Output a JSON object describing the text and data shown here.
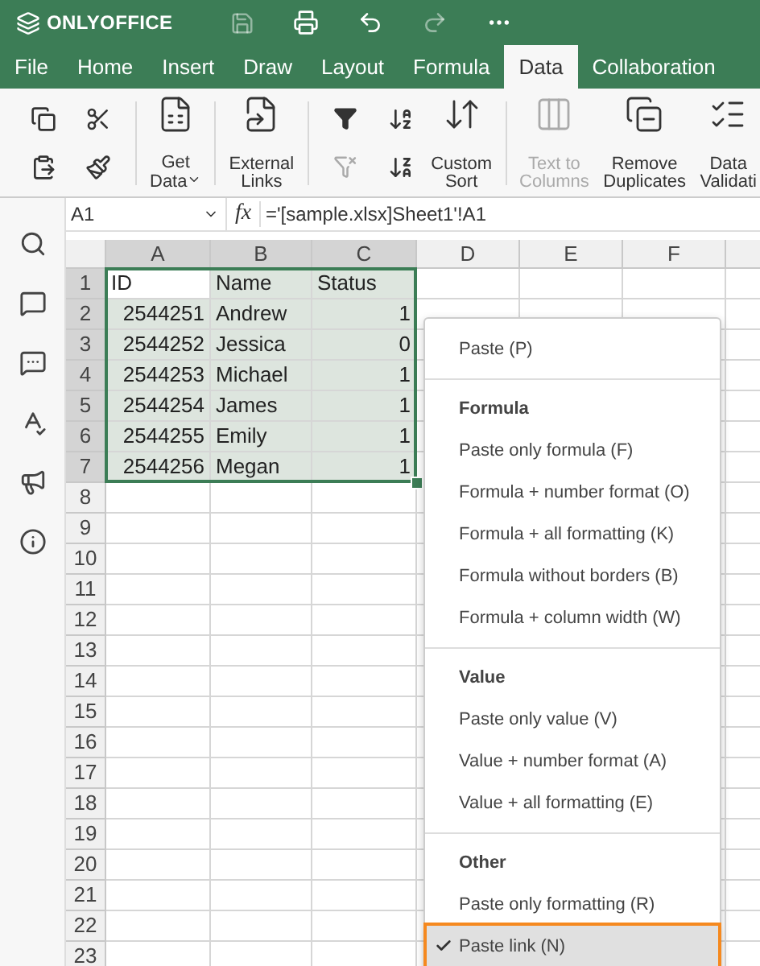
{
  "app": {
    "name": "ONLYOFFICE"
  },
  "tabs": [
    {
      "label": "File",
      "selected": false
    },
    {
      "label": "Home",
      "selected": false
    },
    {
      "label": "Insert",
      "selected": false
    },
    {
      "label": "Draw",
      "selected": false
    },
    {
      "label": "Layout",
      "selected": false
    },
    {
      "label": "Formula",
      "selected": false
    },
    {
      "label": "Data",
      "selected": true
    },
    {
      "label": "Collaboration",
      "selected": false
    }
  ],
  "toolbar": {
    "get_data": {
      "lines": [
        "Get",
        "Data"
      ]
    },
    "external_links": {
      "lines": [
        "External",
        "Links"
      ]
    },
    "custom_sort": {
      "lines": [
        "Custom",
        "Sort"
      ]
    },
    "text_to_columns": {
      "lines": [
        "Text to",
        "Columns"
      ],
      "disabled": true
    },
    "remove_duplicates": {
      "lines": [
        "Remove",
        "Duplicates"
      ],
      "disabled": false
    },
    "data_validation": {
      "lines": [
        "Data",
        "Validati"
      ]
    }
  },
  "formula_bar": {
    "name_box": "A1",
    "fx_label": "fx",
    "formula": "='[sample.xlsx]Sheet1'!A1"
  },
  "sheet": {
    "columns": [
      {
        "label": "A",
        "selected": true
      },
      {
        "label": "B",
        "selected": true
      },
      {
        "label": "C",
        "selected": true
      },
      {
        "label": "D",
        "selected": false
      },
      {
        "label": "E",
        "selected": false
      },
      {
        "label": "F",
        "selected": false
      }
    ],
    "rows": [
      {
        "number": "1",
        "selected": true,
        "cells": [
          {
            "value": "ID",
            "kind": "text",
            "active": true
          },
          {
            "value": "Name",
            "kind": "text",
            "active": false
          },
          {
            "value": "Status",
            "kind": "text",
            "active": false
          }
        ]
      },
      {
        "number": "2",
        "selected": true,
        "cells": [
          {
            "value": "2544251",
            "kind": "number",
            "active": false
          },
          {
            "value": "Andrew",
            "kind": "text",
            "active": false
          },
          {
            "value": "1",
            "kind": "number",
            "active": false
          }
        ]
      },
      {
        "number": "3",
        "selected": true,
        "cells": [
          {
            "value": "2544252",
            "kind": "number",
            "active": false
          },
          {
            "value": "Jessica",
            "kind": "text",
            "active": false
          },
          {
            "value": "0",
            "kind": "number",
            "active": false
          }
        ]
      },
      {
        "number": "4",
        "selected": true,
        "cells": [
          {
            "value": "2544253",
            "kind": "number",
            "active": false
          },
          {
            "value": "Michael",
            "kind": "text",
            "active": false
          },
          {
            "value": "1",
            "kind": "number",
            "active": false
          }
        ]
      },
      {
        "number": "5",
        "selected": true,
        "cells": [
          {
            "value": "2544254",
            "kind": "number",
            "active": false
          },
          {
            "value": "James",
            "kind": "text",
            "active": false
          },
          {
            "value": "1",
            "kind": "number",
            "active": false
          }
        ]
      },
      {
        "number": "6",
        "selected": true,
        "cells": [
          {
            "value": "2544255",
            "kind": "number",
            "active": false
          },
          {
            "value": "Emily",
            "kind": "text",
            "active": false
          },
          {
            "value": "1",
            "kind": "number",
            "active": false
          }
        ]
      },
      {
        "number": "7",
        "selected": true,
        "cells": [
          {
            "value": "2544256",
            "kind": "number",
            "active": false
          },
          {
            "value": "Megan",
            "kind": "text",
            "active": false
          },
          {
            "value": "1",
            "kind": "number",
            "active": false
          }
        ]
      },
      {
        "number": "8",
        "selected": false
      },
      {
        "number": "9",
        "selected": false
      },
      {
        "number": "10",
        "selected": false
      },
      {
        "number": "11",
        "selected": false
      },
      {
        "number": "12",
        "selected": false
      },
      {
        "number": "13",
        "selected": false
      },
      {
        "number": "14",
        "selected": false
      },
      {
        "number": "15",
        "selected": false
      },
      {
        "number": "16",
        "selected": false
      },
      {
        "number": "17",
        "selected": false
      },
      {
        "number": "18",
        "selected": false
      },
      {
        "number": "19",
        "selected": false
      },
      {
        "number": "20",
        "selected": false
      },
      {
        "number": "21",
        "selected": false
      },
      {
        "number": "22",
        "selected": false
      },
      {
        "number": "23",
        "selected": false
      }
    ]
  },
  "context_menu": {
    "sections": [
      {
        "items": [
          {
            "label": "Paste (P)",
            "checked": false,
            "selected": false
          }
        ]
      },
      {
        "header": "Formula",
        "items": [
          {
            "label": "Paste only formula (F)",
            "checked": false,
            "selected": false
          },
          {
            "label": "Formula + number format (O)",
            "checked": false,
            "selected": false
          },
          {
            "label": "Formula + all formatting (K)",
            "checked": false,
            "selected": false
          },
          {
            "label": "Formula without borders (B)",
            "checked": false,
            "selected": false
          },
          {
            "label": "Formula + column width (W)",
            "checked": false,
            "selected": false
          }
        ]
      },
      {
        "header": "Value",
        "items": [
          {
            "label": "Paste only value (V)",
            "checked": false,
            "selected": false
          },
          {
            "label": "Value + number format (A)",
            "checked": false,
            "selected": false
          },
          {
            "label": "Value + all formatting (E)",
            "checked": false,
            "selected": false
          }
        ]
      },
      {
        "header": "Other",
        "items": [
          {
            "label": "Paste only formatting (R)",
            "checked": false,
            "selected": false
          },
          {
            "label": "Paste link (N)",
            "checked": true,
            "selected": true
          }
        ]
      }
    ]
  }
}
